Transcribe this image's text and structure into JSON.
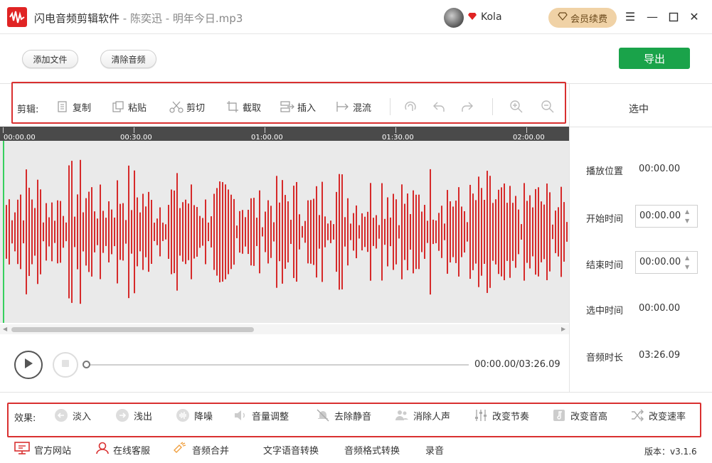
{
  "window": {
    "app_name": "闪电音频剪辑软件",
    "separator": " - ",
    "file_title": "陈奕迅 - 明年今日.mp3",
    "username": "Kola",
    "vip_renew": "会员续费"
  },
  "actions": {
    "add_file": "添加文件",
    "clear_audio": "清除音频",
    "export": "导出"
  },
  "edit_toolbar": {
    "label": "剪辑:",
    "items": [
      {
        "label": "复制",
        "icon": "copy-icon"
      },
      {
        "label": "粘贴",
        "icon": "paste-icon"
      },
      {
        "label": "剪切",
        "icon": "cut-icon"
      },
      {
        "label": "截取",
        "icon": "crop-icon"
      },
      {
        "label": "插入",
        "icon": "insert-icon"
      },
      {
        "label": "混流",
        "icon": "mix-icon"
      }
    ],
    "icon_buttons": [
      "loop-icon",
      "undo-icon",
      "redo-icon",
      "zoom-in-icon",
      "zoom-out-icon"
    ]
  },
  "timeline": {
    "ticks": [
      "00:00.00",
      "00:30.00",
      "01:00.00",
      "01:30.00",
      "02:00.00"
    ],
    "waveform_color": "#d62a2a"
  },
  "player": {
    "time_display": "00:00.00/03:26.09",
    "progress": 0
  },
  "right_panel": {
    "title": "选中",
    "play_position_label": "播放位置",
    "play_position_value": "00:00.00",
    "start_time_label": "开始时间",
    "start_time_value": "00:00.00",
    "end_time_label": "结束时间",
    "end_time_value": "00:00.00",
    "selected_time_label": "选中时间",
    "selected_time_value": "00:00.00",
    "duration_label": "音频时长",
    "duration_value": "03:26.09"
  },
  "effects": {
    "label": "效果:",
    "items": [
      {
        "label": "淡入",
        "icon": "fade-in-icon"
      },
      {
        "label": "浅出",
        "icon": "fade-out-icon"
      },
      {
        "label": "降噪",
        "icon": "denoise-icon"
      },
      {
        "label": "音量调整",
        "icon": "volume-icon"
      },
      {
        "label": "去除静音",
        "icon": "mute-remove-icon"
      },
      {
        "label": "消除人声",
        "icon": "voice-remove-icon"
      },
      {
        "label": "改变节奏",
        "icon": "tempo-icon"
      },
      {
        "label": "改变音高",
        "icon": "pitch-icon"
      },
      {
        "label": "改变速率",
        "icon": "speed-icon"
      }
    ]
  },
  "footer": {
    "items": [
      {
        "label": "官方网站",
        "icon": "website-icon"
      },
      {
        "label": "在线客服",
        "icon": "support-icon"
      },
      {
        "label": "音频合并",
        "icon": "merge-icon"
      },
      {
        "label": "文字语音转换",
        "icon": ""
      },
      {
        "label": "音频格式转换",
        "icon": ""
      },
      {
        "label": "录音",
        "icon": ""
      }
    ],
    "version": "版本：v3.1.6"
  },
  "colors": {
    "accent_red": "#d93030",
    "export_green": "#1aa34a",
    "playhead_green": "#37d05d",
    "vip_gold": "#f0d2a6"
  }
}
